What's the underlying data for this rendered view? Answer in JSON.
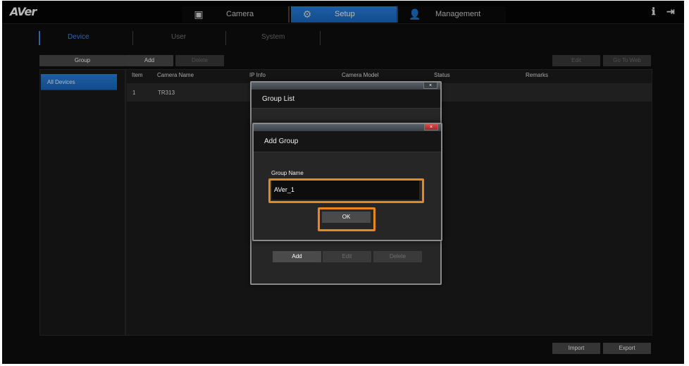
{
  "app": {
    "logo": "AVer"
  },
  "nav": {
    "camera": {
      "label": "Camera",
      "icon": "camera-icon"
    },
    "setup": {
      "label": "Setup",
      "icon": "gear-icon"
    },
    "management": {
      "label": "Management",
      "icon": "user-icon"
    },
    "info_icon": "ℹ",
    "logout_icon": "⇥"
  },
  "subtabs": {
    "device": "Device",
    "user": "User",
    "system": "System"
  },
  "toolbar": {
    "group": "Group",
    "add": "Add",
    "delete": "Delete",
    "edit": "Edit",
    "go_to_web": "Go To Web"
  },
  "sidebar": {
    "all_devices": "All Devices"
  },
  "table": {
    "headers": {
      "item": "Item",
      "camera_name": "Camera Name",
      "ip_info": "IP Info",
      "camera_model": "Camera Model",
      "status": "Status",
      "remarks": "Remarks"
    },
    "rows": [
      {
        "item": "1",
        "camera_name": "TR313"
      }
    ]
  },
  "bottom": {
    "import": "Import",
    "export": "Export"
  },
  "group_list_dialog": {
    "title": "Group List",
    "close": "×",
    "add": "Add",
    "edit": "Edit",
    "delete": "Delete"
  },
  "add_group_dialog": {
    "title": "Add Group",
    "close": "×",
    "field_label": "Group Name",
    "field_value": "AVer_1",
    "ok": "OK"
  },
  "colors": {
    "accent": "#1f78d6",
    "highlight": "#e9861d",
    "background": "#0f0f10"
  }
}
